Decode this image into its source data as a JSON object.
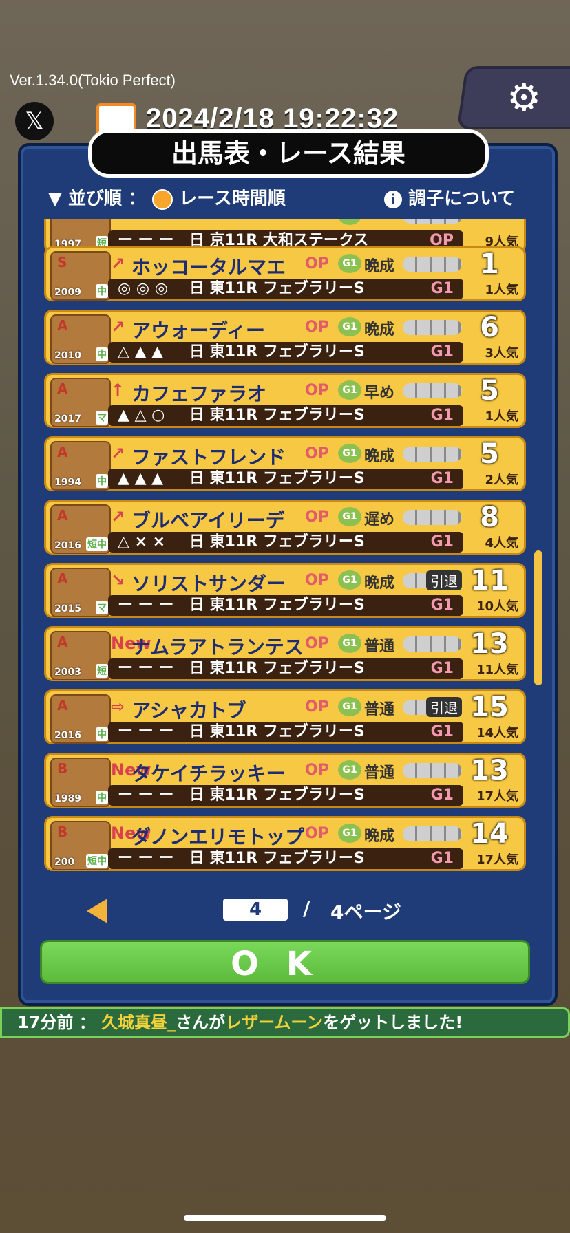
{
  "header": {
    "version": "Ver.1.34.0(Tokio Perfect)",
    "x_label": "𝕏",
    "datetime": "2024/2/18 19:22:32"
  },
  "dialog": {
    "title": "出馬表・レース結果",
    "sort_label": "▼ 並び順 ：",
    "sort_value": "レース時間順",
    "about_label": "調子について"
  },
  "rows": [
    {
      "grade": "",
      "year": "1997",
      "dist": "短",
      "trend": "",
      "name": "",
      "op": "",
      "g1badge": "",
      "growth": "",
      "marks": "ー ー ー",
      "race": "日 京11R 大和ステークス",
      "g1": "OP",
      "place": "",
      "pop": "9人気",
      "retired": ""
    },
    {
      "grade": "S",
      "year": "2009",
      "dist": "中",
      "trend": "↗",
      "name": "ホッコータルマエ",
      "op": "OP",
      "g1badge": "G1",
      "growth": "晩成",
      "marks": "◎ ◎ ◎",
      "race": "日 東11R フェブラリーS",
      "g1": "G1",
      "place": "1",
      "pop": "1人気",
      "retired": ""
    },
    {
      "grade": "A",
      "year": "2010",
      "dist": "中",
      "trend": "↗",
      "name": "アウォーディー",
      "op": "OP",
      "g1badge": "G1",
      "growth": "晩成",
      "marks": "△ ▲ ▲",
      "race": "日 東11R フェブラリーS",
      "g1": "G1",
      "place": "6",
      "pop": "3人気",
      "retired": ""
    },
    {
      "grade": "A",
      "year": "2017",
      "dist": "マ",
      "trend": "↑",
      "name": "カフェファラオ",
      "op": "OP",
      "g1badge": "G1",
      "growth": "早め",
      "marks": "▲ △ ○",
      "race": "日 東11R フェブラリーS",
      "g1": "G1",
      "place": "5",
      "pop": "1人気",
      "retired": ""
    },
    {
      "grade": "A",
      "year": "1994",
      "dist": "中",
      "trend": "↗",
      "name": "ファストフレンド",
      "op": "OP",
      "g1badge": "G1",
      "growth": "晩成",
      "marks": "▲ ▲ ▲",
      "race": "日 東11R フェブラリーS",
      "g1": "G1",
      "place": "5",
      "pop": "2人気",
      "retired": ""
    },
    {
      "grade": "A",
      "year": "2016",
      "dist": "短中",
      "trend": "↗",
      "name": "ブルベアイリーデ",
      "op": "OP",
      "g1badge": "G1",
      "growth": "遅め",
      "marks": "△ × ×",
      "race": "日 東11R フェブラリーS",
      "g1": "G1",
      "place": "8",
      "pop": "4人気",
      "retired": ""
    },
    {
      "grade": "A",
      "year": "2015",
      "dist": "マ",
      "trend": "↘",
      "name": "ソリストサンダー",
      "op": "OP",
      "g1badge": "G1",
      "growth": "晩成",
      "marks": "ー ー ー",
      "race": "日 東11R フェブラリーS",
      "g1": "G1",
      "place": "11",
      "pop": "10人気",
      "retired": "引退"
    },
    {
      "grade": "A",
      "year": "2003",
      "dist": "短",
      "trend": "New",
      "name": "ナムラアトランテス",
      "op": "OP",
      "g1badge": "G1",
      "growth": "普通",
      "marks": "ー ー ー",
      "race": "日 東11R フェブラリーS",
      "g1": "G1",
      "place": "13",
      "pop": "11人気",
      "retired": ""
    },
    {
      "grade": "A",
      "year": "2016",
      "dist": "中",
      "trend": "⇨",
      "name": "アシャカトブ",
      "op": "OP",
      "g1badge": "G1",
      "growth": "普通",
      "marks": "ー ー ー",
      "race": "日 東11R フェブラリーS",
      "g1": "G1",
      "place": "15",
      "pop": "14人気",
      "retired": "引退"
    },
    {
      "grade": "B",
      "year": "1989",
      "dist": "中",
      "trend": "New",
      "name": "タケイチラッキー",
      "op": "OP",
      "g1badge": "G1",
      "growth": "普通",
      "marks": "ー ー ー",
      "race": "日 東11R フェブラリーS",
      "g1": "G1",
      "place": "13",
      "pop": "17人気",
      "retired": ""
    },
    {
      "grade": "B",
      "year": "200",
      "dist": "短中",
      "trend": "New",
      "name": "ダノンエリモトップ",
      "op": "OP",
      "g1badge": "G1",
      "growth": "晩成",
      "marks": "ー ー ー",
      "race": "日 東11R フェブラリーS",
      "g1": "G1",
      "place": "14",
      "pop": "17人気",
      "retired": ""
    }
  ],
  "pager": {
    "current": "4",
    "separator": "/",
    "total": "4ページ"
  },
  "ok_label": "OK",
  "ticker": {
    "time": "17分前 ：",
    "user": "久城真昼_",
    "mid": "さんが",
    "item": "レザームーン",
    "tail": "をゲットしました!"
  }
}
